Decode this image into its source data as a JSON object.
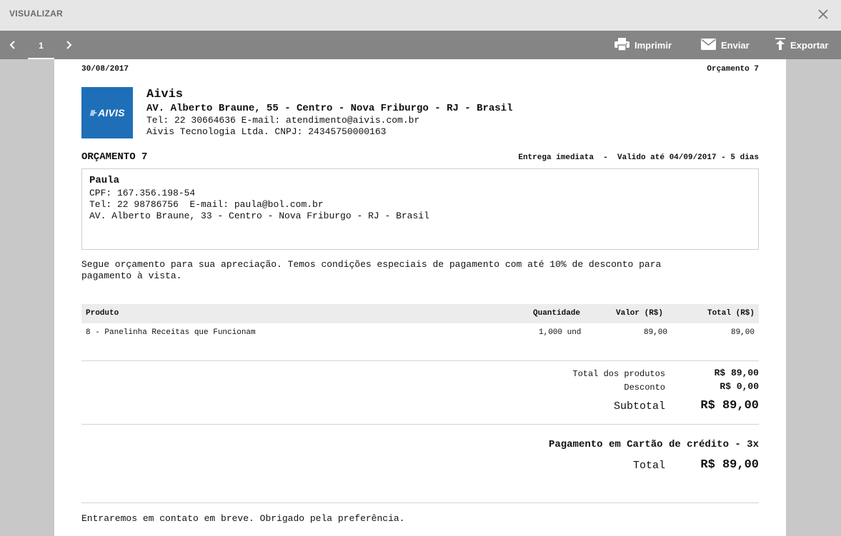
{
  "window": {
    "title": "VISUALIZAR"
  },
  "toolbar": {
    "page": "1",
    "print_label": "Imprimir",
    "send_label": "Enviar",
    "export_label": "Exportar"
  },
  "doc": {
    "date": "30/08/2017",
    "ref": "Orçamento 7",
    "company": {
      "logo_text": "AIVIS",
      "name": "Aivis",
      "address": "AV. Alberto Braune, 55 - Centro - Nova Friburgo - RJ - Brasil",
      "contact": "Tel: 22 30664636  E-mail: atendimento@aivis.com.br",
      "legal": "Aivis Tecnologia Ltda.  CNPJ: 24345750000163"
    },
    "heading": "ORÇAMENTO 7",
    "delivery": "Entrega imediata  -  Valido até 04/09/2017 - 5 dias",
    "client": {
      "name": "Paula",
      "cpf": "CPF: 167.356.198-54",
      "contact": "Tel: 22 98786756  E-mail: paula@bol.com.br",
      "address": "AV. Alberto Braune, 33 - Centro - Nova Friburgo - RJ - Brasil"
    },
    "intro_line1": "Segue orçamento para sua apreciação. Temos condições especiais de pagamento com até 10% de desconto para",
    "intro_line2": "pagamento à vista.",
    "table": {
      "headers": [
        "Produto",
        "Quantidade",
        "Valor (R$)",
        "Total (R$)"
      ],
      "rows": [
        [
          "8 - Panelinha Receitas que Funcionam",
          "1,000 und",
          "89,00",
          "89,00"
        ]
      ]
    },
    "totals": {
      "products_label": "Total dos produtos",
      "products_value": "R$ 89,00",
      "discount_label": "Desconto",
      "discount_value": "R$ 0,00",
      "subtotal_label": "Subtotal",
      "subtotal_value": "R$ 89,00"
    },
    "payment": "Pagamento em Cartão de crédito - 3x",
    "total_label": "Total",
    "total_value": "R$ 89,00",
    "footer": "Entraremos em contato em breve. Obrigado pela preferência."
  },
  "colors": {
    "toolbar": "#858585",
    "logo": "#1f6fb8",
    "table_head": "#ececec"
  }
}
